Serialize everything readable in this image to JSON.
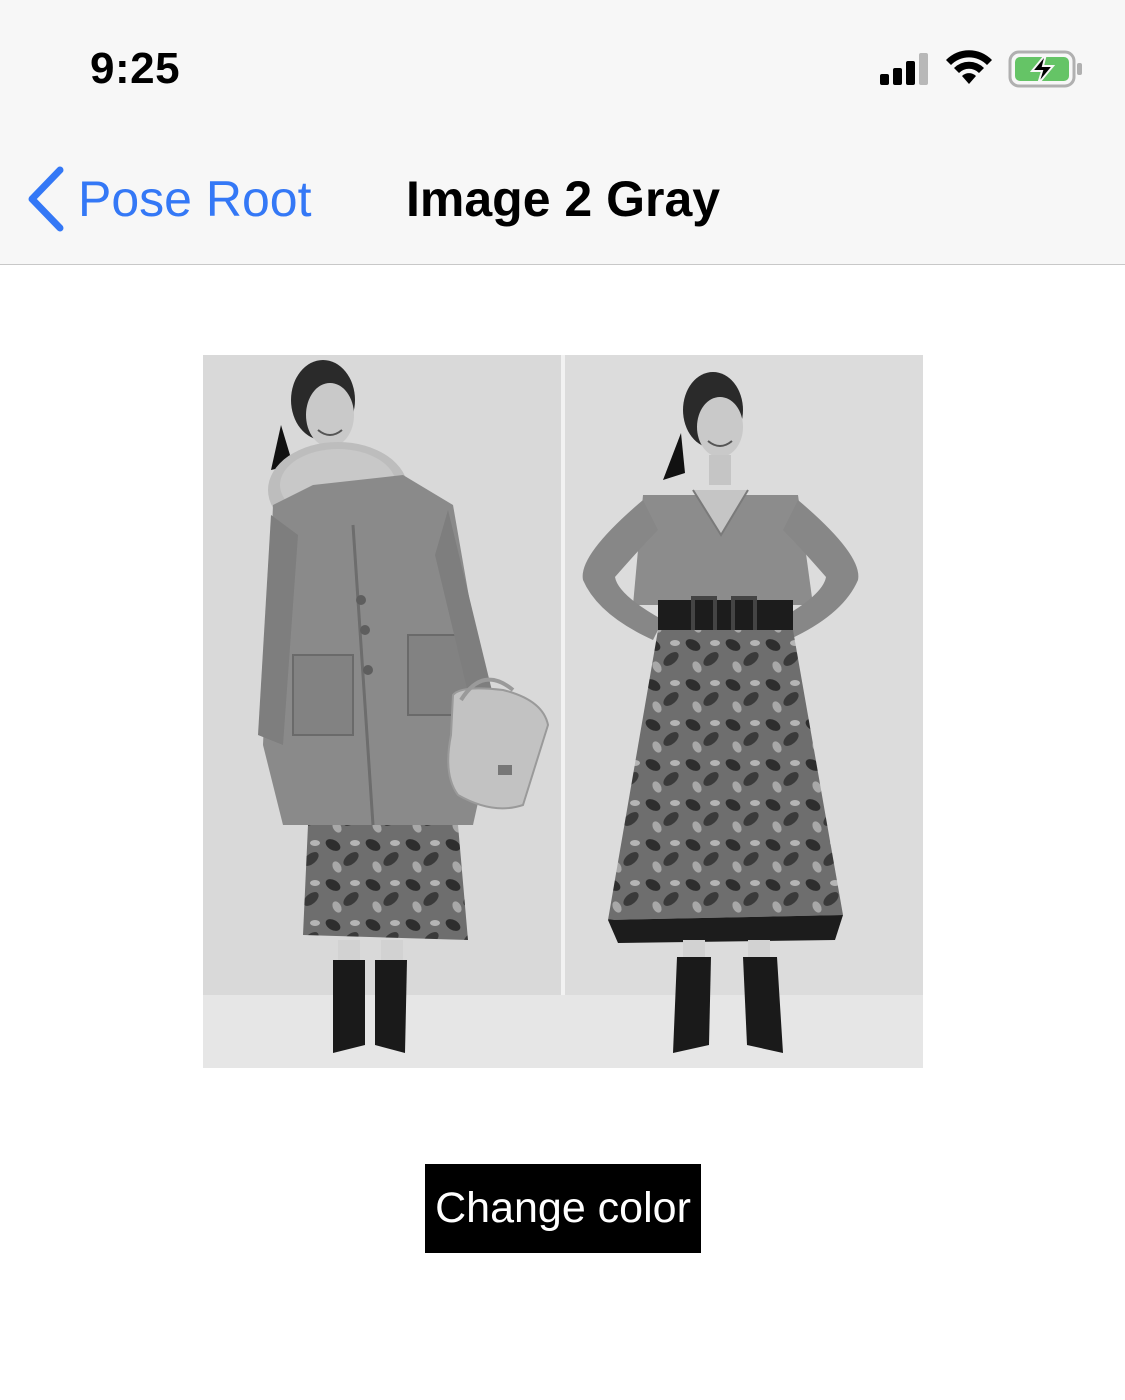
{
  "status_bar": {
    "time": "9:25",
    "icons": [
      "cellular-signal-icon",
      "wifi-icon",
      "battery-charging-icon"
    ],
    "battery_color": "#65c466"
  },
  "nav_bar": {
    "back_label": "Pose Root",
    "title": "Image 2 Gray",
    "accent_color": "#3478f6"
  },
  "content": {
    "image_description": "grayscale-fashion-photo",
    "button_label": "Change color"
  }
}
